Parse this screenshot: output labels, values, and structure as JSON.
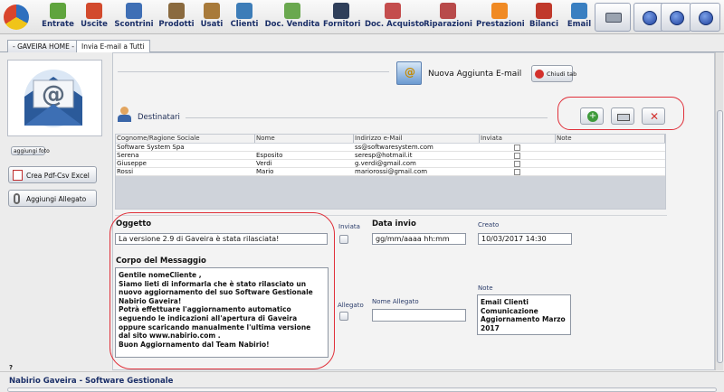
{
  "toolbar": {
    "items": [
      {
        "label": "Entrate",
        "color": "#5fa43d"
      },
      {
        "label": "Uscite",
        "color": "#d24a2d"
      },
      {
        "label": "Scontrini",
        "color": "#3f6fb5"
      },
      {
        "label": "Prodotti",
        "color": "#8a6a3f"
      },
      {
        "label": "Usati",
        "color": "#a87a3a"
      },
      {
        "label": "Clienti",
        "color": "#3d7db8"
      },
      {
        "label": "Doc. Vendita",
        "color": "#6aa84f"
      },
      {
        "label": "Fornitori",
        "color": "#2f3f5a"
      },
      {
        "label": "Doc. Acquisto",
        "color": "#c44d4d"
      },
      {
        "label": "Riparazioni",
        "color": "#b84a4a"
      },
      {
        "label": "Prestazioni",
        "color": "#f08a24"
      },
      {
        "label": "Bilanci",
        "color": "#c0392b"
      },
      {
        "label": "Email",
        "color": "#3a7fc1"
      }
    ]
  },
  "tabs": [
    "- GAVEIRA HOME -",
    "Invia E-mail a Tutti"
  ],
  "sidebar": {
    "add_photo": "aggiungi foto",
    "pdf_button": "Crea Pdf-Csv Excel",
    "attach_button": "Aggiungi Allegato"
  },
  "header": {
    "title": "Nuova Aggiunta E-mail",
    "close_button": "Chiudi tab"
  },
  "recipients": {
    "section_title": "Destinatari",
    "columns": [
      "Cognome/Ragione Sociale",
      "Nome",
      "Indirizzo e-Mail",
      "Inviata",
      "Note"
    ],
    "rows": [
      {
        "surname": "Software System Spa",
        "name": "",
        "email": "ss@softwaresystem.com"
      },
      {
        "surname": "Serena",
        "name": "Esposito",
        "email": "seresp@hotmail.it"
      },
      {
        "surname": "Giuseppe",
        "name": "Verdi",
        "email": "g.verdi@gmail.com"
      },
      {
        "surname": "Rossi",
        "name": "Mario",
        "email": "mariorossi@gmail.com"
      }
    ]
  },
  "form": {
    "subject_label": "Oggetto",
    "subject_value": "La versione 2.9 di Gaveira è stata rilasciata!",
    "sent_label": "Inviata",
    "send_date_label": "Data invio",
    "send_date_placeholder": "gg/mm/aaaa hh:mm",
    "created_label": "Creato",
    "created_value": "10/03/2017 14:30",
    "body_label": "Corpo del Messaggio",
    "body_lines": [
      "Gentile nomeCliente ,",
      "Siamo lieti di informarla che è stato rilasciato un",
      "nuovo aggiornamento del suo Software Gestionale",
      "Nabirio Gaveira!",
      "Potrà effettuare l'aggiornamento automatico",
      "seguendo le indicazioni all'apertura di Gaveira",
      "oppure scaricando manualmente l'ultima versione",
      "dal sito www.nabirio.com .",
      "Buon Aggiornamento dal Team Nabirio!"
    ],
    "attachment_label": "Allegato",
    "attachment_name_label": "Nome Allegato",
    "notes_label": "Note",
    "notes_lines": [
      "Email Clienti",
      "Comunicazione",
      "Aggiornamento Marzo",
      "2017"
    ]
  },
  "status": {
    "marker": "?",
    "text": "Nabirio Gaveira - Software Gestionale"
  },
  "colors": {
    "accent_red": "#e0303a",
    "toolbar_text": "#1b2f68"
  }
}
